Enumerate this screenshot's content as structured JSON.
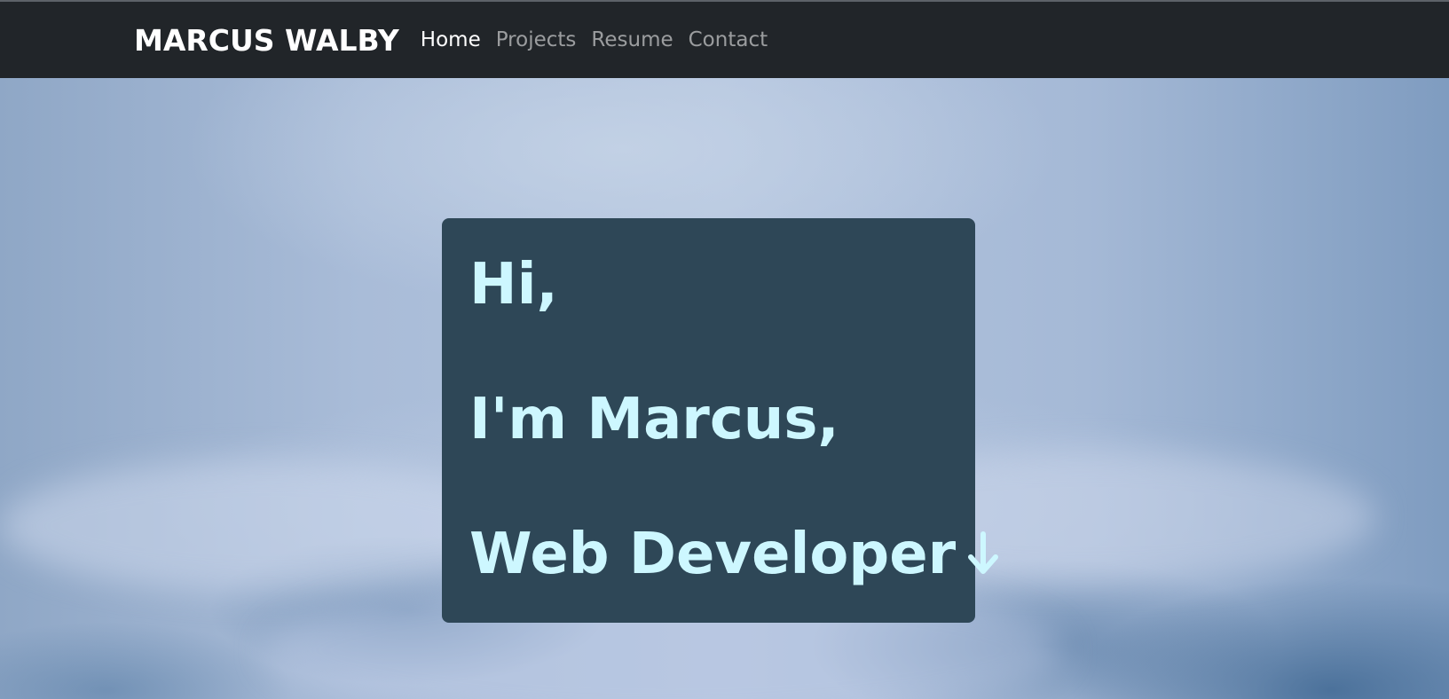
{
  "navbar": {
    "brand": "MARCUS WALBY",
    "links": [
      {
        "label": "Home",
        "active": true
      },
      {
        "label": "Projects",
        "active": false
      },
      {
        "label": "Resume",
        "active": false
      },
      {
        "label": "Contact",
        "active": false
      }
    ]
  },
  "hero": {
    "line1": "Hi,",
    "line2": "I'm Marcus,",
    "line3": "Web Developer",
    "arrow_icon": "arrow-down-icon"
  },
  "colors": {
    "navbar_bg": "#212529",
    "card_bg": "#2e4757",
    "hero_text": "#cdf7ff",
    "nav_active": "#ffffff",
    "nav_inactive": "#9a9da0"
  }
}
